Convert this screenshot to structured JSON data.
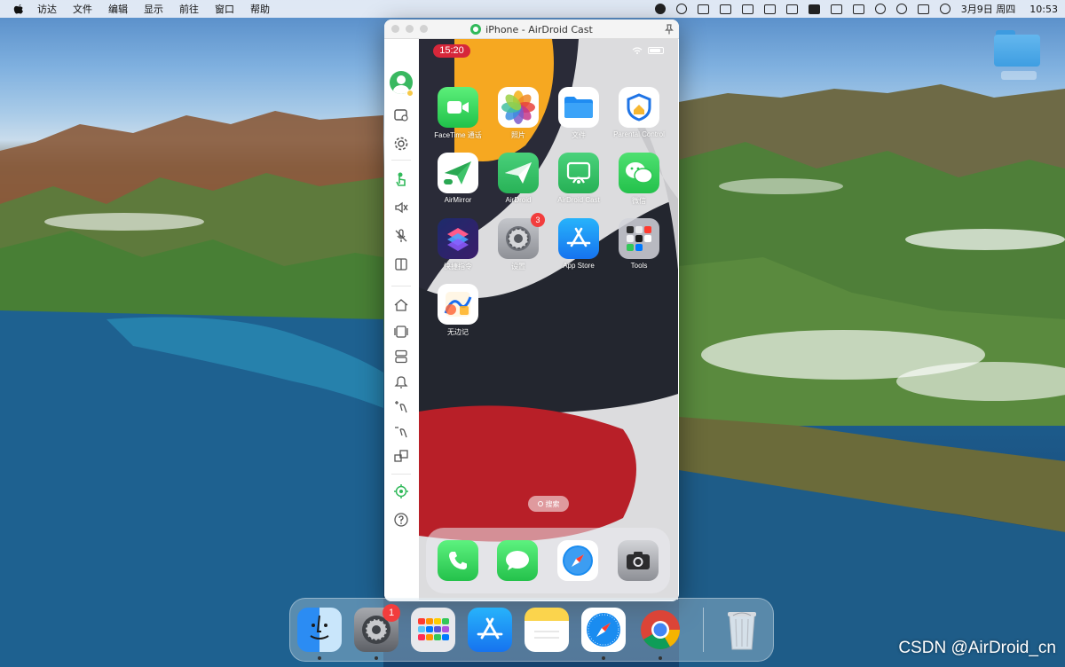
{
  "menubar": {
    "items": [
      "访达",
      "文件",
      "编辑",
      "显示",
      "前往",
      "窗口",
      "帮助"
    ],
    "date": "3月9日 周四",
    "time": "10:53"
  },
  "window": {
    "title": "iPhone - AirDroid Cast"
  },
  "phone": {
    "status_time": "15:20",
    "apps": [
      {
        "label": "FaceTime 通话",
        "icon": "facetime-icon"
      },
      {
        "label": "照片",
        "icon": "photos-icon"
      },
      {
        "label": "文件",
        "icon": "files-icon"
      },
      {
        "label": "Parental Control",
        "icon": "parental-control-icon"
      },
      {
        "label": "AirMirror",
        "icon": "airmirror-icon"
      },
      {
        "label": "AirDroid",
        "icon": "airdroid-icon"
      },
      {
        "label": "AirDroid Cast",
        "icon": "airdroid-cast-icon"
      },
      {
        "label": "微信",
        "icon": "wechat-icon"
      },
      {
        "label": "快捷指令",
        "icon": "shortcuts-icon"
      },
      {
        "label": "设置",
        "icon": "settings-icon",
        "badge": "3"
      },
      {
        "label": "App Store",
        "icon": "app-store-icon"
      },
      {
        "label": "Tools",
        "icon": "tools-folder-icon"
      },
      {
        "label": "无边记",
        "icon": "freeform-icon"
      }
    ],
    "search_label": "搜索",
    "dock": [
      "phone-icon",
      "messages-icon",
      "safari-icon",
      "camera-icon"
    ]
  },
  "mac_dock": {
    "apps": [
      "finder-icon",
      "system-settings-icon",
      "launchpad-icon",
      "app-store-icon",
      "notes-icon",
      "safari-icon",
      "chrome-icon",
      "trash-icon"
    ],
    "settings_badge": "1"
  },
  "watermark": "CSDN @AirDroid_cn",
  "colors": {
    "accent_green": "#31b95a",
    "badge_red": "#f23d3d",
    "status_time_red": "#d6273a"
  }
}
